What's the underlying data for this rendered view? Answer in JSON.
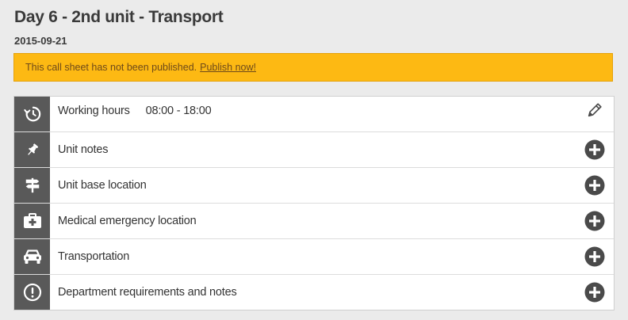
{
  "page": {
    "title": "Day 6 - 2nd unit - Transport",
    "date": "2015-09-21"
  },
  "alert": {
    "message": "This call sheet has not been published.",
    "link": "Publish now!",
    "background": "#fdb913"
  },
  "sections": [
    {
      "label": "Working hours",
      "value": "08:00 - 18:00",
      "icon": "clock-history-icon",
      "action": "pencil-icon"
    },
    {
      "label": "Unit notes",
      "icon": "pushpin-icon",
      "action": "plus-circle-icon"
    },
    {
      "label": "Unit base location",
      "icon": "signpost-icon",
      "action": "plus-circle-icon"
    },
    {
      "label": "Medical emergency location",
      "icon": "first-aid-kit-icon",
      "action": "plus-circle-icon"
    },
    {
      "label": "Transportation",
      "icon": "car-icon",
      "action": "plus-circle-icon"
    },
    {
      "label": "Department requirements and notes",
      "icon": "exclamation-circle-icon",
      "action": "plus-circle-icon"
    }
  ],
  "colors": {
    "icon_column": "#595959",
    "action_icon": "#4a4a4a",
    "background": "#ebebeb"
  }
}
